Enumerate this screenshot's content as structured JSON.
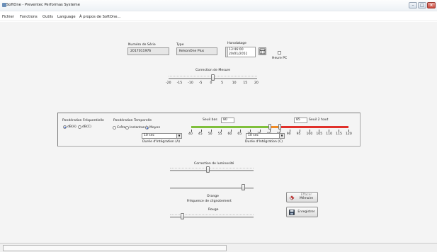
{
  "window": {
    "title": "SoftOne - Preventec Performas Systeme"
  },
  "menu": [
    "Fichier",
    "Fonctions",
    "Outils",
    "Language",
    "À propos de SoftOne..."
  ],
  "device": {
    "serial_label": "Numéro de Série",
    "serial_value": "2017011976",
    "type_label": "Type",
    "type_value": "KelsonOne Plus",
    "timestamp_label": "Horodatage",
    "time_value": "13:46:00",
    "date_value": "20/01/2051",
    "pc_time_label": "Heure PC"
  },
  "correction": {
    "label": "Correction de Mesure",
    "ticks": [
      "-20",
      "-15",
      "-10",
      "-5",
      "0",
      "5",
      "10",
      "15",
      "20"
    ],
    "value": 0
  },
  "panel": {
    "freq_label": "Pondération Fréquentielle",
    "freq_options": [
      "dB(A)",
      "dB(C)"
    ],
    "freq_selected": "dB(A)",
    "temp_label": "Pondération Temporelle",
    "temp_options": [
      "Crête",
      "Instantané",
      "Moyen"
    ],
    "temp_selected": "Moyen",
    "low_threshold_label": "Seuil bas",
    "low_threshold_value": "80",
    "high_threshold_value": "85",
    "high_threshold_label": "Seuil 2 haut",
    "scale_ticks": [
      "40",
      "45",
      "50",
      "55",
      "60",
      "65",
      "70",
      "75",
      "80",
      "85",
      "90",
      "95",
      "100",
      "105",
      "110",
      "115",
      "120"
    ]
  },
  "integration": {
    "a_value": "10 sec",
    "a_label": "Durée d'Intégration (A)",
    "c_value": "10 sec",
    "c_label": "Durée d'Intégration (C)"
  },
  "brightness": {
    "label": "Correction de luminosité",
    "value_fraction": 0.45
  },
  "blink": {
    "orange_label": "Orange",
    "freq_label": "Fréquence de clignotement",
    "red_label": "Rouge",
    "orange_fraction": 0.88,
    "red_fraction": 0.15
  },
  "buttons": {
    "erase_label_1": "Effacer",
    "erase_label_2": "Mémoire",
    "save_label": "Enregistrer"
  },
  "colors": {
    "green_zone": "#7fbf3b",
    "orange_zone": "#f08a24",
    "red_zone": "#e0302a"
  }
}
